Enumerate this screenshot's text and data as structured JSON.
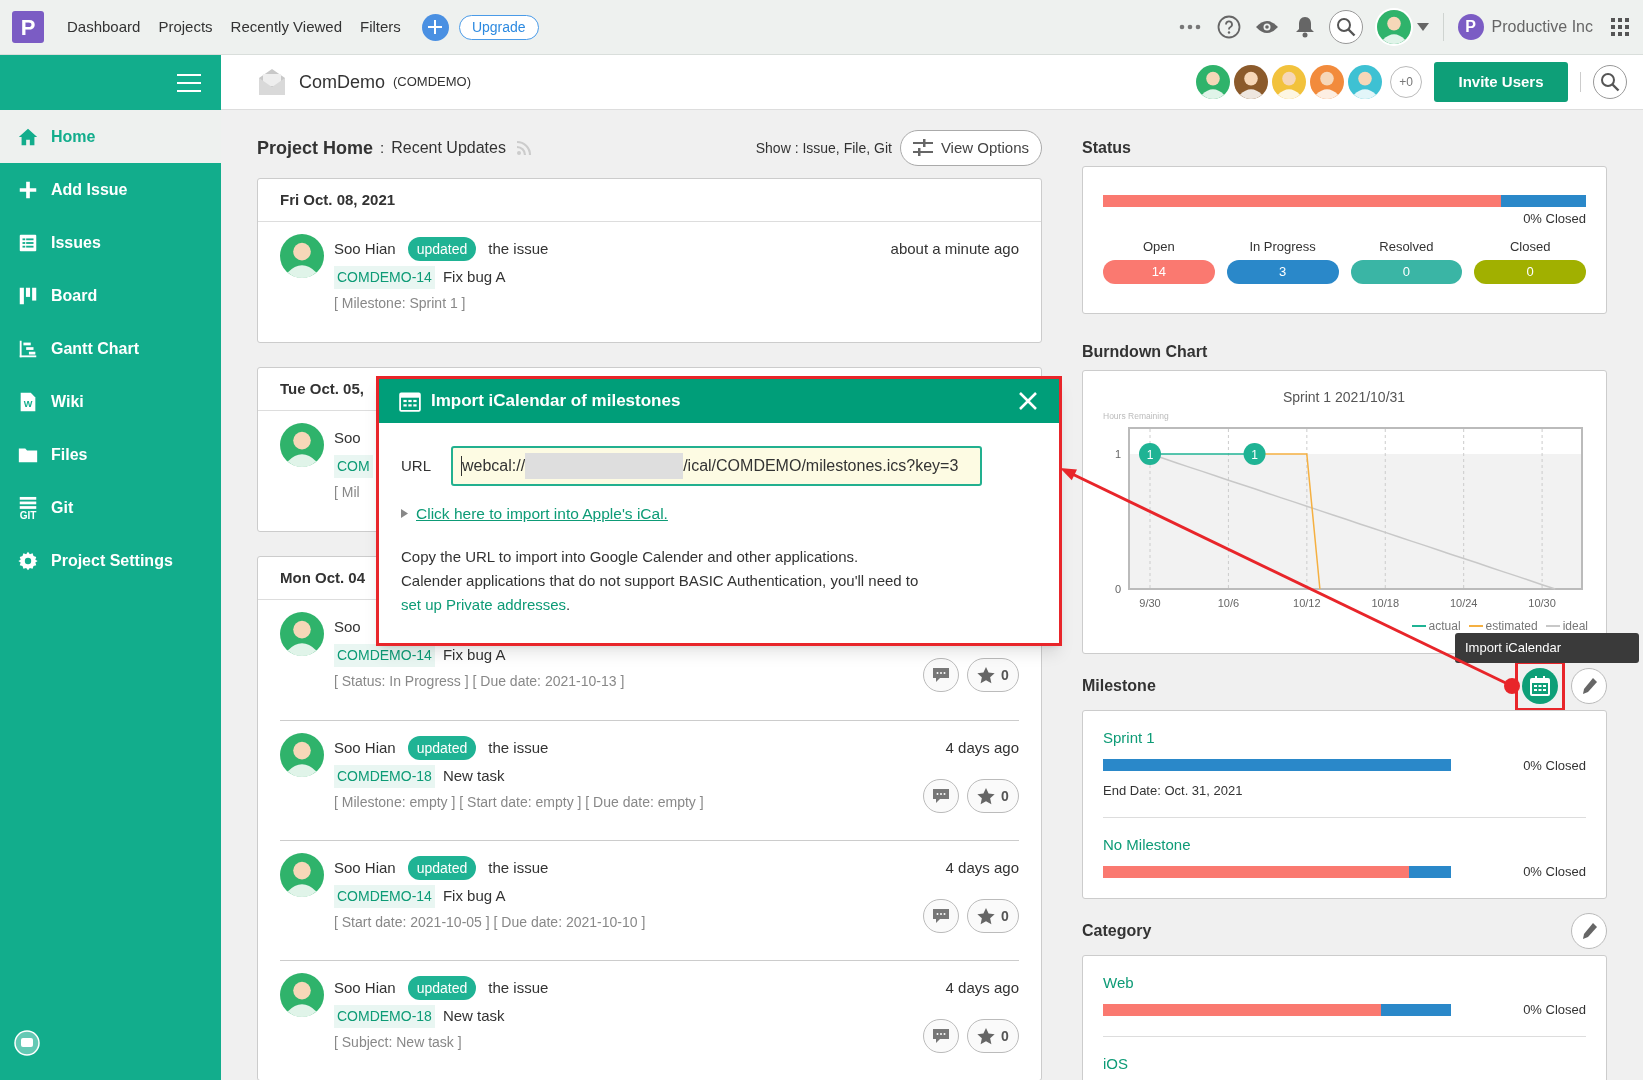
{
  "topbar": {
    "logo": "P",
    "nav": [
      {
        "label": "Dashboard"
      },
      {
        "label": "Projects"
      },
      {
        "label": "Recently Viewed"
      },
      {
        "label": "Filters"
      }
    ],
    "upgrade": "Upgrade",
    "org_logo": "P",
    "org_name": "Productive Inc"
  },
  "sidebar": {
    "items": [
      {
        "label": "Home",
        "kind": "home",
        "selected": true
      },
      {
        "label": "Add Issue",
        "kind": "plus",
        "selected": false
      },
      {
        "label": "Issues",
        "kind": "list",
        "selected": false
      },
      {
        "label": "Board",
        "kind": "board",
        "selected": false
      },
      {
        "label": "Gantt Chart",
        "kind": "gantt",
        "selected": false
      },
      {
        "label": "Wiki",
        "kind": "wiki",
        "icon_text": "W",
        "selected": false
      },
      {
        "label": "Files",
        "kind": "files",
        "selected": false
      },
      {
        "label": "Git",
        "kind": "git",
        "icon_text": "GIT",
        "selected": false
      },
      {
        "label": "Project Settings",
        "kind": "settings",
        "selected": false
      }
    ]
  },
  "project": {
    "name": "ComDemo",
    "key": "(COMDEMO)",
    "members": [
      {
        "color": "#2fb36b"
      },
      {
        "color": "#8b5a2b"
      },
      {
        "color": "#f2c23c"
      },
      {
        "color": "#f28b3c"
      },
      {
        "color": "#3ec1d3"
      }
    ],
    "member_overflow": "+0",
    "invite": "Invite Users"
  },
  "feed": {
    "title": "Project Home",
    "separator": ":",
    "subtitle": "Recent Updates",
    "show": "Show : Issue, File, Git",
    "view_options": "View Options",
    "groups": [
      {
        "date": "Fri Oct. 08, 2021",
        "entries": [
          {
            "author": "Soo Hian",
            "action": "updated",
            "object": "the issue",
            "time": "about a minute ago",
            "key": "COMDEMO-14",
            "title": "Fix bug A",
            "details": "[ Milestone: Sprint 1 ]"
          }
        ]
      },
      {
        "date": "Tue Oct. 05,",
        "entries": [
          {
            "author": "Soo",
            "key": "COM",
            "details": "[ Mil"
          }
        ]
      },
      {
        "date": "Mon Oct. 04",
        "entries": [
          {
            "author": "Soo",
            "key": "COMDEMO-14",
            "title": "Fix bug A",
            "details": "[ Status: In Progress ] [ Due date: 2021-10-13 ]",
            "star_count": "0"
          },
          {
            "author": "Soo Hian",
            "action": "updated",
            "object": "the issue",
            "time": "4 days ago",
            "key": "COMDEMO-18",
            "title": "New task",
            "details": "[ Milestone: empty ] [ Start date: empty ] [ Due date: empty ]",
            "star_count": "0"
          },
          {
            "author": "Soo Hian",
            "action": "updated",
            "object": "the issue",
            "time": "4 days ago",
            "key": "COMDEMO-14",
            "title": "Fix bug A",
            "details": "[ Start date: 2021-10-05 ] [ Due date: 2021-10-10 ]",
            "star_count": "0"
          },
          {
            "author": "Soo Hian",
            "action": "updated",
            "object": "the issue",
            "time": "4 days ago",
            "key": "COMDEMO-18",
            "title": "New task",
            "details": "[ Subject: New task ]",
            "star_count": "0"
          }
        ]
      }
    ]
  },
  "status": {
    "title": "Status",
    "bar": {
      "level": 0.824
    },
    "closed": "0% Closed",
    "counts": [
      {
        "label": "Open",
        "count": "14",
        "color": "#fa7970"
      },
      {
        "label": "In Progress",
        "count": "3",
        "color": "#2a88c9"
      },
      {
        "label": "Resolved",
        "count": "0",
        "color": "#3ab5a5"
      },
      {
        "label": "Closed",
        "count": "0",
        "color": "#a1b000"
      }
    ]
  },
  "burndown": {
    "title": "Burndown Chart",
    "chart_data": {
      "type": "line",
      "title": "Sprint 1 2021/10/31",
      "ylabel": "Hours Remaining",
      "categories": [
        "9/30",
        null,
        null,
        null,
        null,
        null,
        "10/6",
        null,
        null,
        null,
        null,
        null,
        "10/12",
        null,
        null,
        null,
        null,
        null,
        "10/18",
        null,
        null,
        null,
        null,
        null,
        "10/24",
        null,
        null,
        null,
        null,
        null,
        "10/30",
        null
      ],
      "ylim": [
        0,
        1
      ],
      "yticks": [
        0,
        1
      ],
      "legend": "bottom-right",
      "series": [
        {
          "name": "actual",
          "color": "#1fb394",
          "values": [
            1,
            1,
            1,
            1,
            1,
            1,
            1,
            1,
            1,
            null,
            null,
            null,
            null,
            null,
            null,
            null,
            null,
            null,
            null,
            null,
            null,
            null,
            null,
            null,
            null,
            null,
            null,
            null,
            null,
            null,
            null,
            null
          ],
          "value_labels": [
            "1",
            null,
            null,
            null,
            null,
            null,
            null,
            null,
            "1",
            null,
            null,
            null,
            null,
            null,
            null,
            null,
            null,
            null,
            null,
            null,
            null,
            null,
            null,
            null,
            null,
            null,
            null,
            null,
            null,
            null,
            null,
            null
          ]
        },
        {
          "name": "estimated",
          "color": "#f5b041",
          "values": [
            null,
            null,
            null,
            null,
            null,
            null,
            null,
            null,
            1,
            1,
            1,
            1,
            1,
            0,
            null,
            null,
            null,
            null,
            null,
            null,
            null,
            null,
            null,
            null,
            null,
            null,
            null,
            null,
            null,
            null,
            null,
            null
          ]
        },
        {
          "name": "ideal",
          "color": "#c8c8c8",
          "values": [
            1,
            0.968,
            0.935,
            0.903,
            0.871,
            0.839,
            0.806,
            0.774,
            0.742,
            0.71,
            0.677,
            0.645,
            0.613,
            0.581,
            0.548,
            0.516,
            0.484,
            0.452,
            0.419,
            0.387,
            0.355,
            0.323,
            0.29,
            0.258,
            0.226,
            0.194,
            0.161,
            0.129,
            0.097,
            0.065,
            0.032,
            0
          ]
        }
      ]
    }
  },
  "milestone": {
    "title": "Milestone",
    "tooltip": "Import iCalendar",
    "items": [
      {
        "name": "Sprint 1",
        "bar": {
          "level": 0
        },
        "closed": "0% Closed",
        "end_date": "End Date: Oct. 31, 2021"
      },
      {
        "name": "No Milestone",
        "bar": {
          "level": 0.88
        },
        "closed": "0% Closed"
      }
    ]
  },
  "category": {
    "title": "Category",
    "items": [
      {
        "name": "Web",
        "bar": {
          "level": 0.8
        },
        "closed": "0% Closed"
      },
      {
        "name": "iOS"
      }
    ]
  },
  "dialog": {
    "title": "Import iCalendar of milestones",
    "url_label": "URL",
    "url_start": "webcal://",
    "redacted": true,
    "url_end": "/ical/COMDEMO/milestones.ics?key=3",
    "apple_link": "Click here to import into Apple's iCal.",
    "line1": "Copy the URL to import into Google Calender and other applications.",
    "line2": "Calender applications that do not support BASIC Authentication, you'll need to ",
    "line2_link": "set up Private addresses",
    "line2_end": "."
  }
}
